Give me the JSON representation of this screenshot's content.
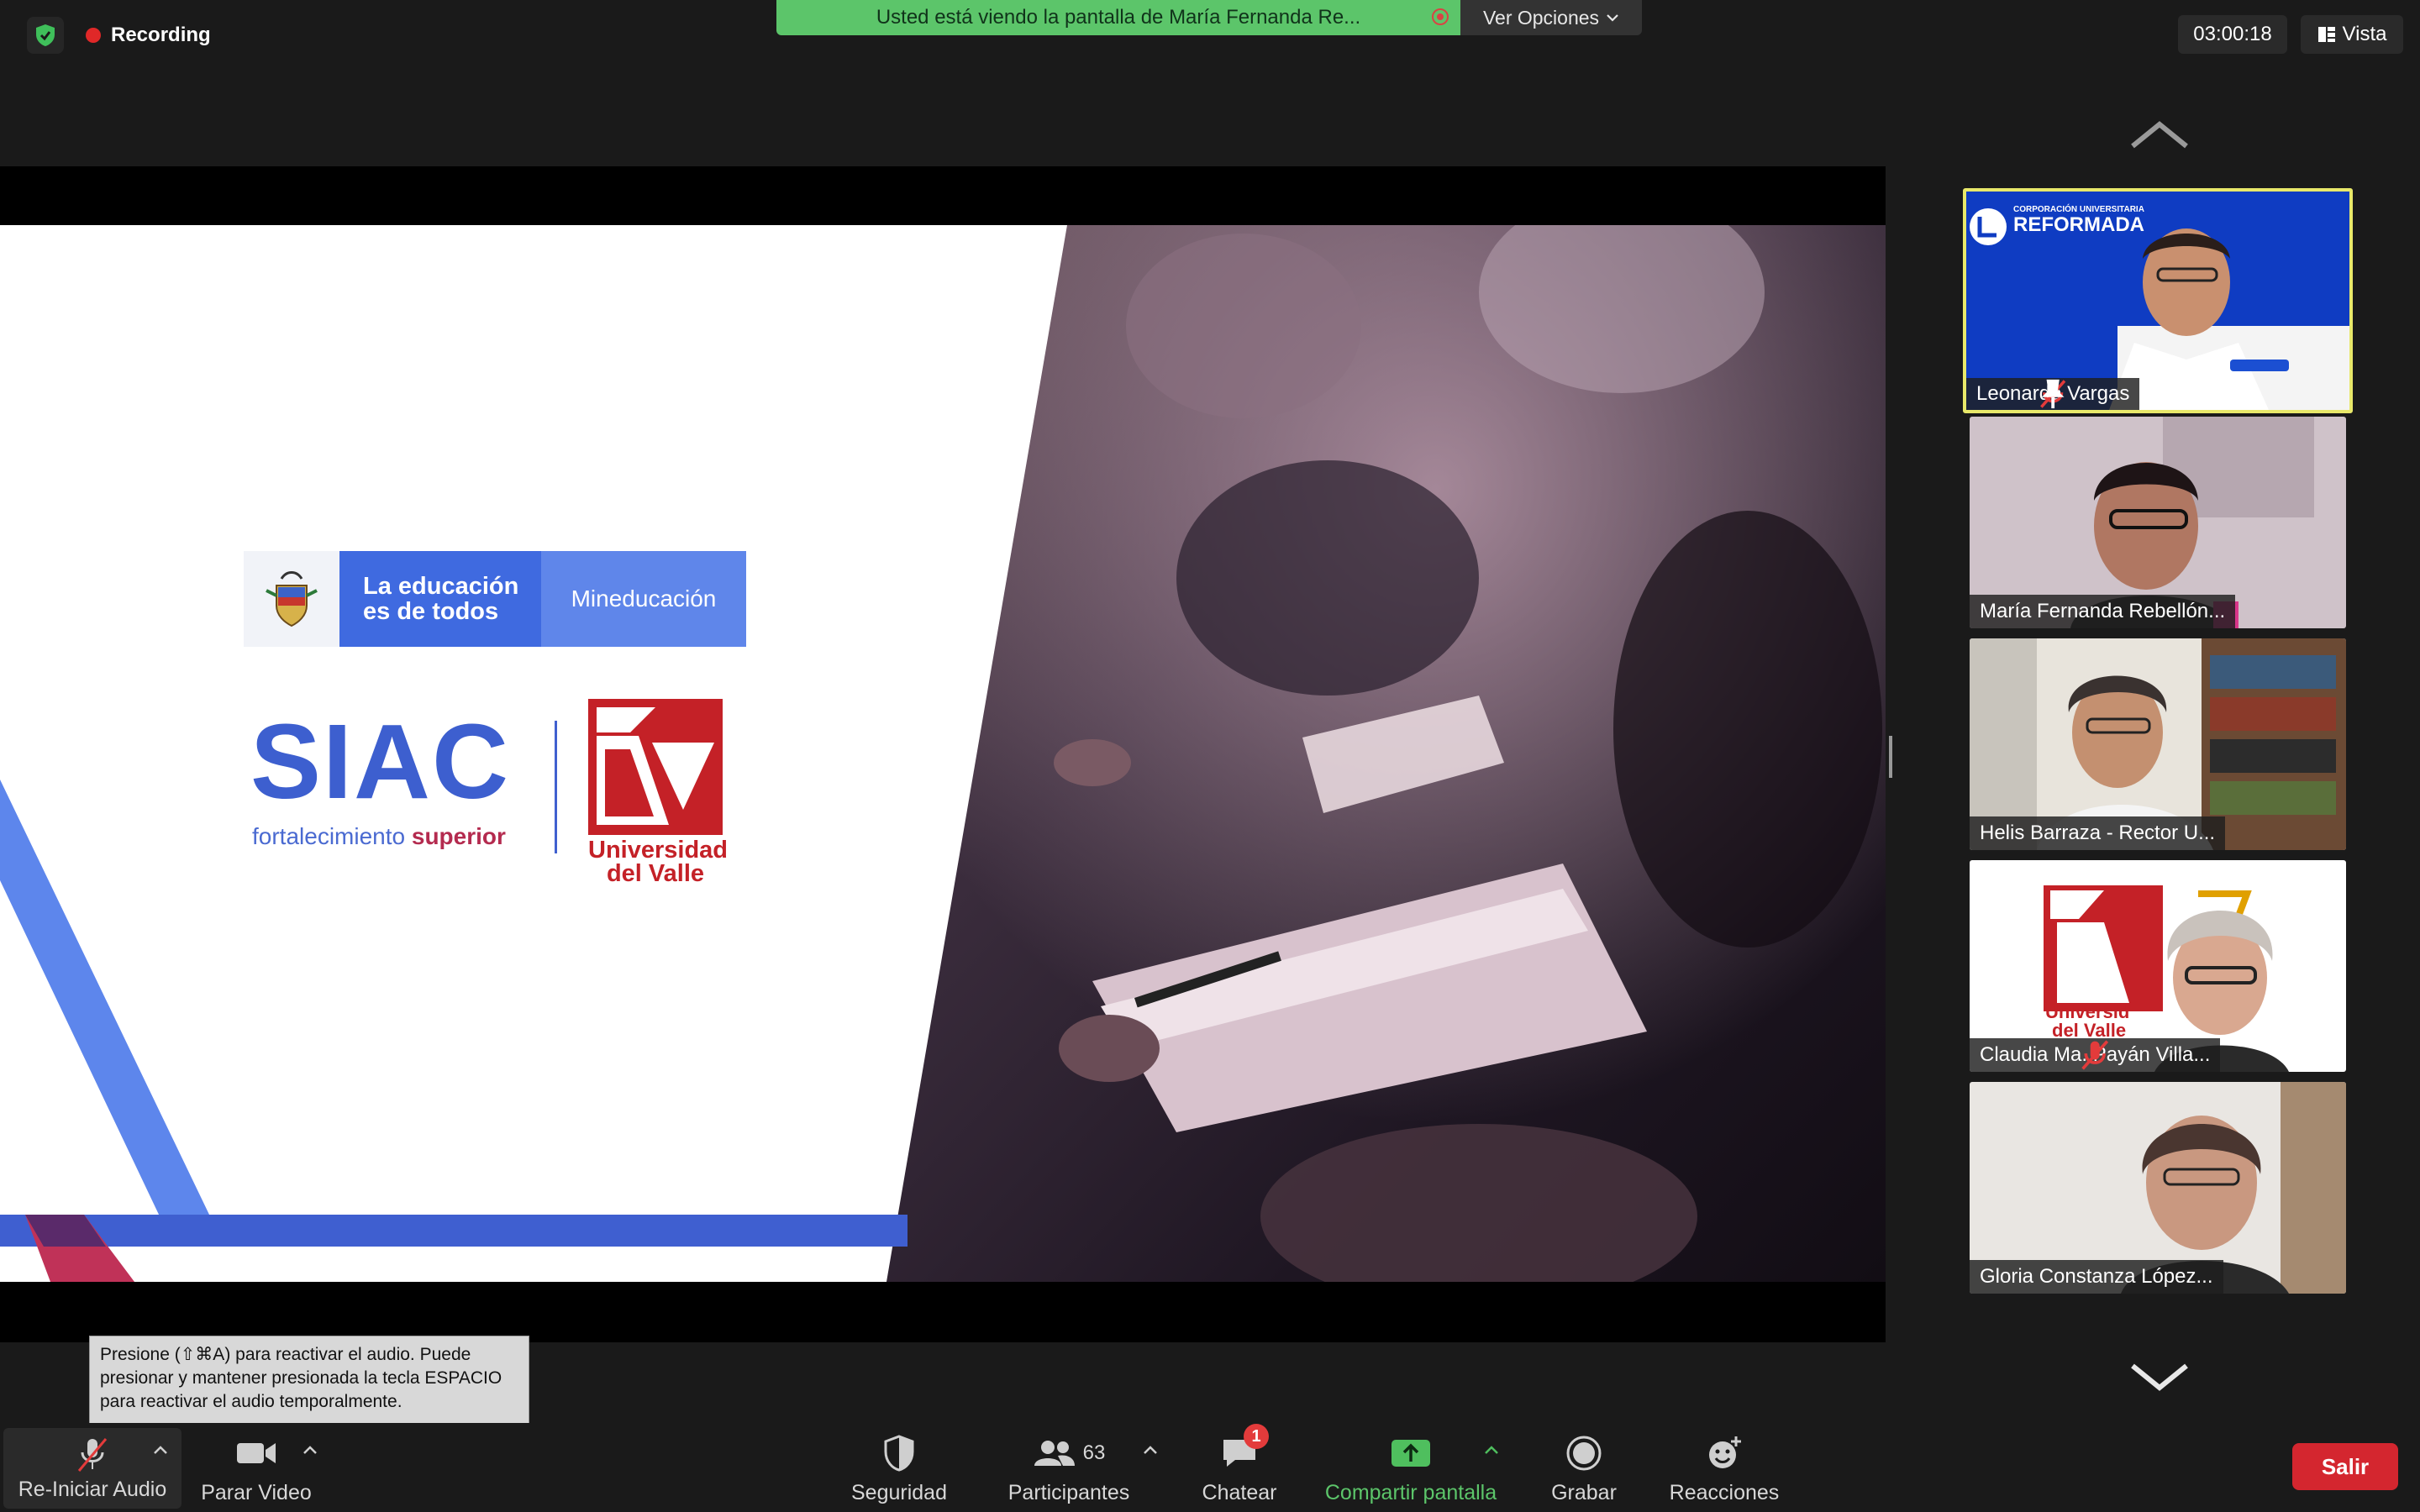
{
  "top_bar": {
    "recording_label": "Recording",
    "share_banner_text": "Usted está viendo la pantalla de María Fernanda Re...",
    "view_options_label": "Ver Opciones",
    "timer": "03:00:18",
    "view_label": "Vista"
  },
  "slide": {
    "gov_logo_line1": "La educación",
    "gov_logo_line2": "es de todos",
    "gov_logo_ministry": "Mineducación",
    "siac_title": "SIAC",
    "siac_subtitle_regular": "fortalecimiento",
    "siac_subtitle_bold": "superior",
    "univalle_line1": "Universidad",
    "univalle_line2": "del Valle"
  },
  "gallery": [
    {
      "name": "Leonardo Vargas",
      "muted": true,
      "pinned": true,
      "active_speaker": true,
      "background_text": "CORPORACIÓN UNIVERSITARIA",
      "background_brand": "REFORMADA"
    },
    {
      "name": "María Fernanda Rebellón...",
      "muted": false
    },
    {
      "name": "Helis Barraza - Rector U...",
      "muted": false
    },
    {
      "name": "Claudia Ma. Payán Villa...",
      "muted": true,
      "background_text_1": "Universid",
      "background_text_2": "del Valle"
    },
    {
      "name": "Gloria Constanza López...",
      "muted": false
    }
  ],
  "tooltip": {
    "text": "Presione  (⇧⌘A) para reactivar el audio. Puede presionar y mantener presionada la tecla ESPACIO para reactivar el audio temporalmente."
  },
  "toolbar": {
    "audio_label": "Re-Iniciar Audio",
    "video_label": "Parar Video",
    "security_label": "Seguridad",
    "participants_label": "Participantes",
    "participants_count": "63",
    "chat_label": "Chatear",
    "chat_badge": "1",
    "share_label": "Compartir pantalla",
    "record_label": "Grabar",
    "reactions_label": "Reacciones",
    "leave_label": "Salir"
  },
  "colors": {
    "share_green": "#5cc56a",
    "leave_red": "#d4262f",
    "active_speaker_border": "#e8e86a",
    "siac_blue": "#3d5fcf"
  }
}
